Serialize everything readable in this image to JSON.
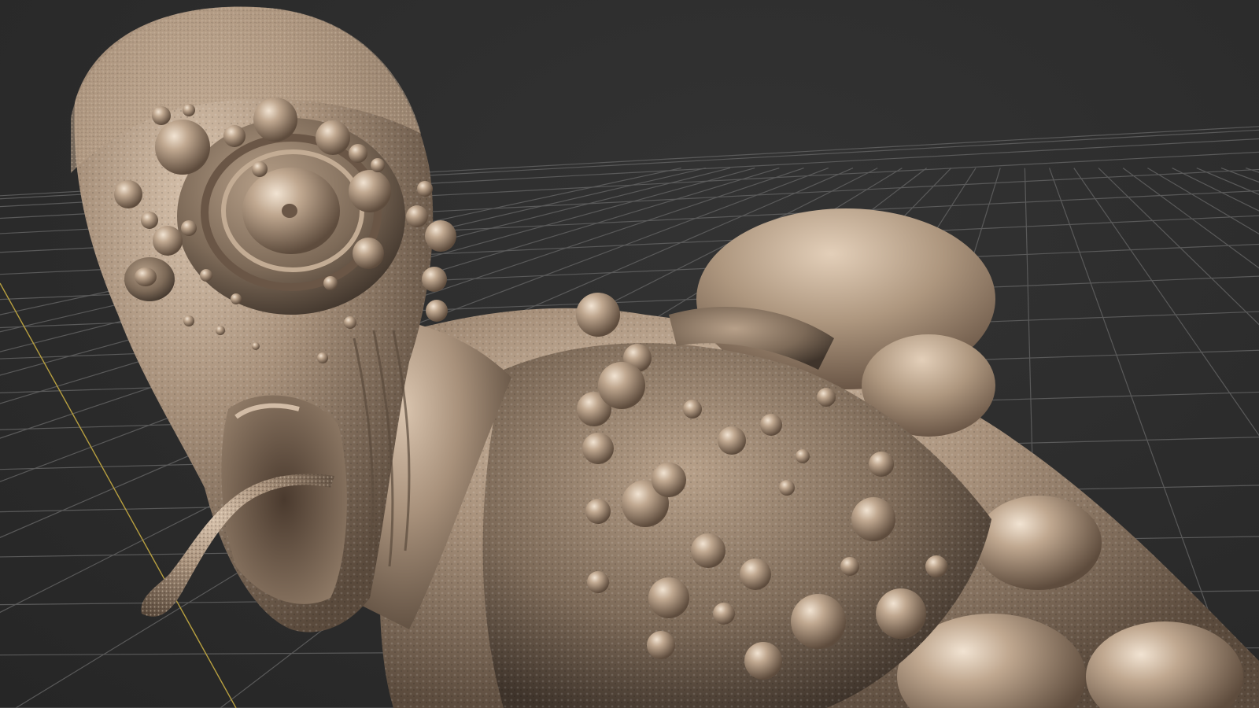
{
  "viewport": {
    "background_color": "#2b2b2b",
    "grid_color": "#5a5a5a",
    "axis_color": "#b8a040",
    "mesh_color": "#a38d78"
  },
  "scene": {
    "object": "sculpted-creature-mesh",
    "shading": "matcap"
  }
}
